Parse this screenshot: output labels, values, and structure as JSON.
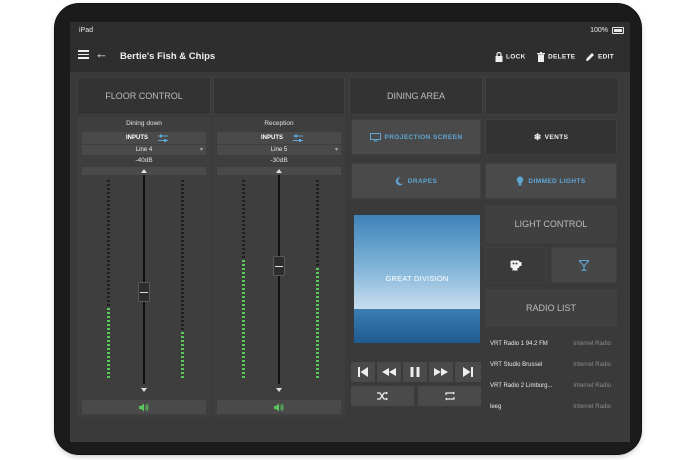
{
  "status": {
    "device": "iPad",
    "battery": "100%"
  },
  "header": {
    "title": "Bertie's Fish & Chips",
    "lock": "LOCK",
    "delete": "DELETE",
    "edit": "EDIT"
  },
  "floor_control": {
    "title": "FLOOR CONTROL",
    "channels": [
      {
        "name": "Dining down",
        "inputs": "INPUTS",
        "line": "Line 4",
        "level": "-40dB"
      },
      {
        "name": "Reception",
        "inputs": "INPUTS",
        "line": "Line 5",
        "level": "-30dB"
      }
    ]
  },
  "dining_area": {
    "title": "DINING AREA",
    "buttons": {
      "projection": "PROJECTION SCREEN",
      "vents": "VENTS",
      "drapes": "DRAPES",
      "dimmed": "DIMMED LIGHTS"
    }
  },
  "light_control": {
    "title": "LIGHT CONTROL"
  },
  "album": {
    "caption": "GREAT DIVISION"
  },
  "radio_list": {
    "title": "RADIO LIST",
    "items": [
      {
        "name": "VRT Radio 1 94.2 FM",
        "type": "Internet Radio"
      },
      {
        "name": "VRT Studio Brussel",
        "type": "Internet Radio"
      },
      {
        "name": "VRT Radio 2 Limburg...",
        "type": "Internet Radio"
      },
      {
        "name": "leeg",
        "type": "Internet Radio"
      }
    ]
  },
  "colors": {
    "accent": "#5ea6d6",
    "meter_on": "#59c95b",
    "meter_off": "#202021",
    "background": "#3a3a3b"
  },
  "icons": [
    "menu-icon",
    "back-arrow-icon",
    "lock-icon",
    "delete-icon",
    "edit-icon",
    "sliders-icon",
    "dropdown-icon",
    "speaker-icon",
    "monitor-icon",
    "snowflake-icon",
    "moon-icon",
    "bulb-icon",
    "lamp-icon",
    "cocktail-icon",
    "previous-icon",
    "rewind-icon",
    "pause-icon",
    "fast-forward-icon",
    "next-icon",
    "shuffle-icon",
    "repeat-icon"
  ]
}
